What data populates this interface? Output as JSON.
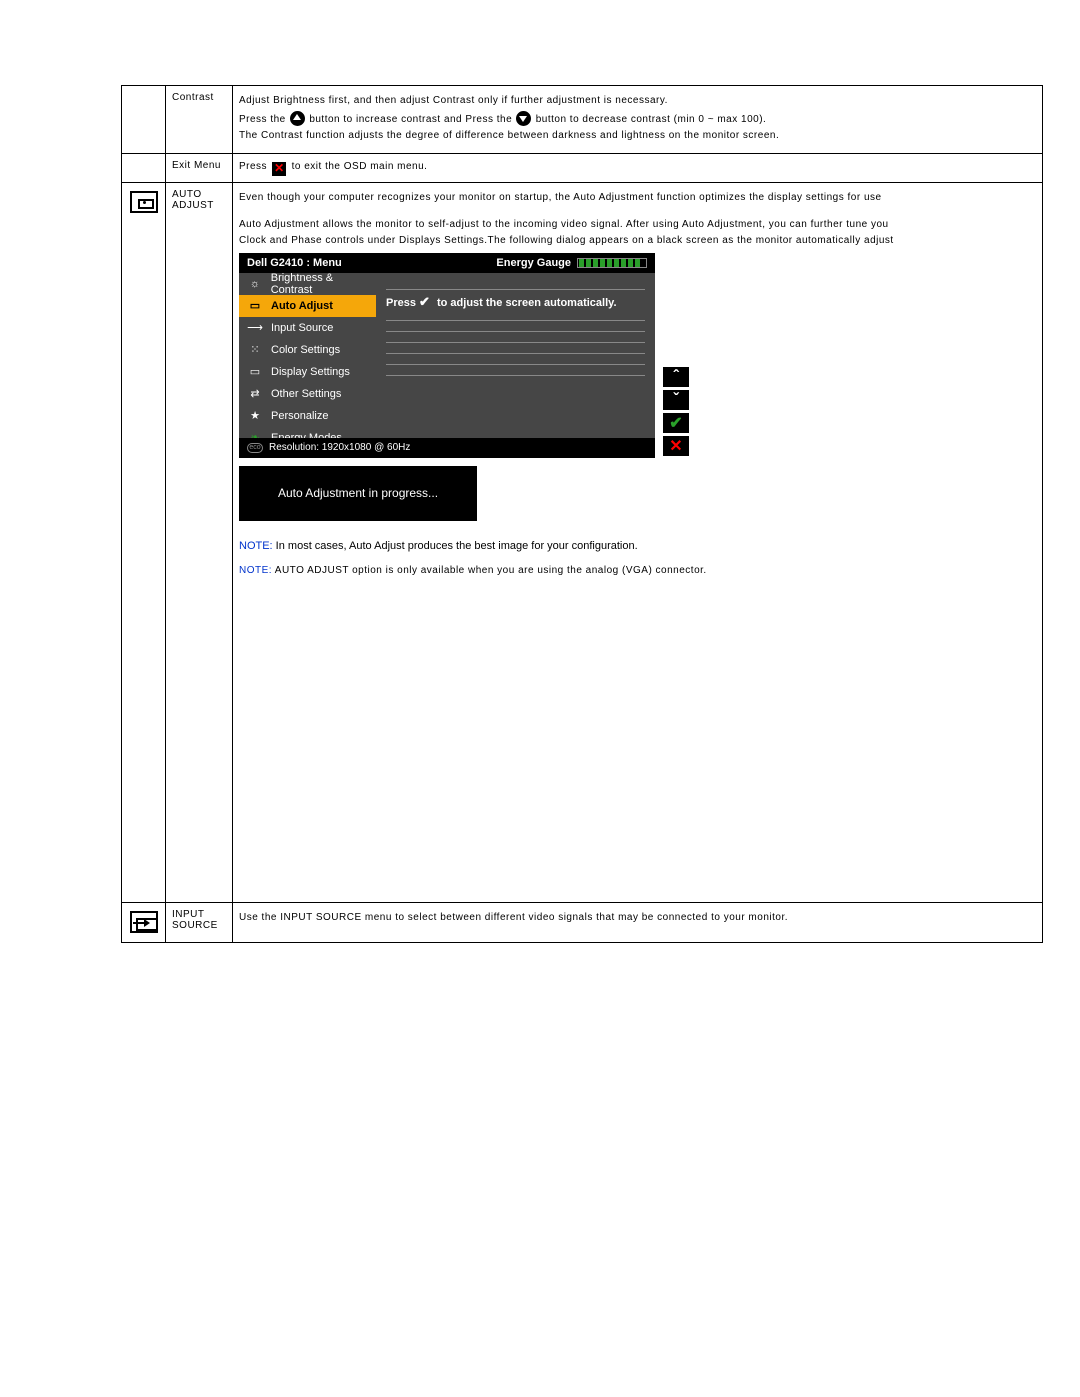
{
  "rows": {
    "contrast": {
      "label": "Contrast",
      "line1": "Adjust Brightness first, and then adjust Contrast only if further adjustment is necessary.",
      "line2_a": "Press the ",
      "line2_b": " button to increase contrast and Press the ",
      "line2_c": " button to decrease contrast (min 0 ~ max 100).",
      "line3": "The Contrast function adjusts the degree of difference between darkness and lightness on the monitor screen."
    },
    "exit": {
      "label": "Exit Menu",
      "text_a": "Press ",
      "text_b": " to exit the OSD main menu."
    },
    "auto_adjust": {
      "label": "AUTO ADJUST",
      "p1": "Even though your computer recognizes your monitor on startup, the Auto Adjustment function optimizes the display settings for use",
      "p2": "Auto Adjustment allows the monitor to self-adjust to the incoming video signal. After using Auto Adjustment, you can further tune you",
      "p3": "Clock and Phase controls under Displays Settings.The following dialog appears on a black screen as the monitor automatically adjust",
      "progress": "Auto Adjustment in progress...",
      "note1_label": "NOTE:",
      "note1_text": " In most cases, Auto Adjust produces the best image for your configuration.",
      "note2_label": "NOTE:",
      "note2_text": " AUTO ADJUST option is only available when you are using the analog (VGA) connector."
    },
    "input_source": {
      "label": "INPUT SOURCE",
      "text": "Use the INPUT SOURCE menu to select between different video signals that may be connected to your monitor."
    }
  },
  "osd": {
    "title": "Dell G2410 : Menu",
    "energy_label": "Energy Gauge",
    "items": [
      "Brightness & Contrast",
      "Auto Adjust",
      "Input Source",
      "Color Settings",
      "Display Settings",
      "Other Settings",
      "Personalize",
      "Energy Modes"
    ],
    "prompt_a": "Press ",
    "prompt_b": " to adjust the screen automatically.",
    "resolution": "Resolution: 1920x1080 @ 60Hz"
  }
}
